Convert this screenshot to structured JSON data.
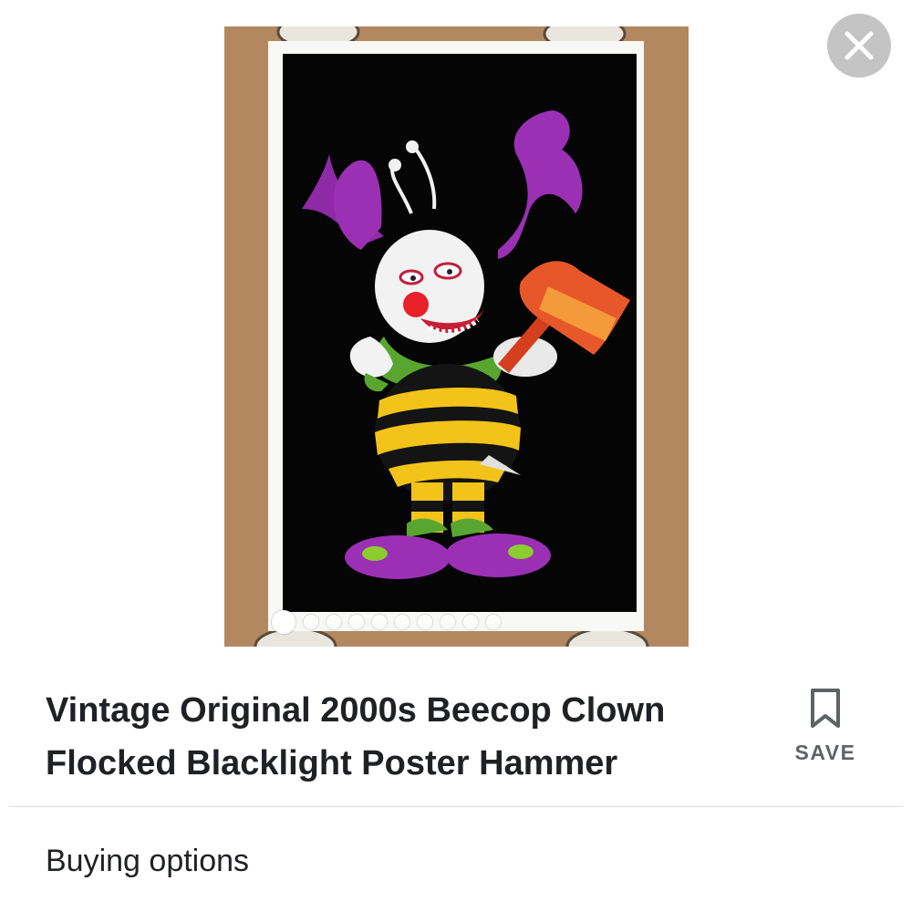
{
  "product": {
    "title_line1": "Vintage Original 2000s Beecop Clown",
    "title_line2": "Flocked Blacklight Poster Hammer"
  },
  "image": {
    "description_alt": "Blacklight poster of a bee clown holding a hammer",
    "carousel": {
      "total_images": 10,
      "current_index": 1
    }
  },
  "actions": {
    "close_icon": "close-icon",
    "save_icon": "bookmark-icon",
    "save_label": "SAVE"
  },
  "sections": {
    "buying_options_label": "Buying options"
  },
  "colors": {
    "text_primary": "#202124",
    "text_secondary": "#5f6368",
    "divider": "#dadce0",
    "close_bg": "#c4c4c4",
    "photo_bg": "#b38760"
  }
}
